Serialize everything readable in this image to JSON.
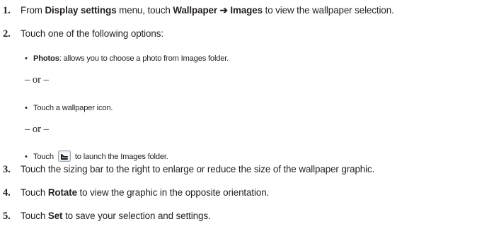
{
  "steps": [
    {
      "number": "1.",
      "parts": [
        "From ",
        "Display settings",
        " menu, touch ",
        "Wallpaper",
        " ➔ ",
        "Images",
        " to view the wallpaper selection."
      ]
    },
    {
      "number": "2.",
      "parts": [
        "Touch one of the following options:"
      ]
    },
    {
      "number": "3.",
      "parts": [
        "Touch the sizing bar to the right to enlarge or reduce the size of the wallpaper graphic."
      ]
    },
    {
      "number": "4.",
      "parts": [
        "Touch ",
        "Rotate",
        " to view the graphic in the opposite orientation."
      ]
    },
    {
      "number": "5.",
      "parts": [
        "Touch ",
        "Set",
        " to save your selection and settings."
      ]
    }
  ],
  "options": [
    {
      "bullet": "•",
      "bold": "Photos",
      "text": ": allows you to choose a photo from Images folder."
    },
    {
      "bullet": "•",
      "text": "Touch a wallpaper icon."
    },
    {
      "bullet": "•",
      "before": "Touch",
      "icon": "images-folder-icon",
      "after": "to launch the Images folder."
    }
  ],
  "separator": "– or –"
}
